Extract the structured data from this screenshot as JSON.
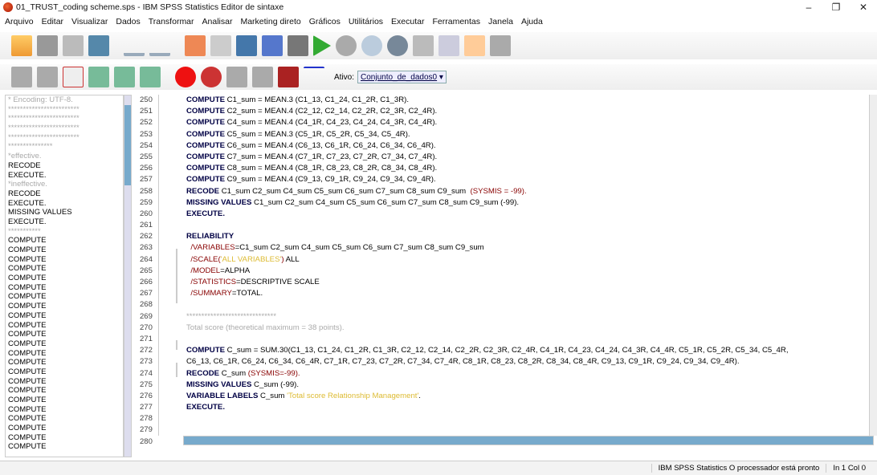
{
  "title": "01_TRUST_coding scheme.sps - IBM SPSS Statistics Editor de sintaxe",
  "menu": [
    "Arquivo",
    "Editar",
    "Visualizar",
    "Dados",
    "Transformar",
    "Analisar",
    "Marketing direto",
    "Gráficos",
    "Utilitários",
    "Executar",
    "Ferramentas",
    "Janela",
    "Ajuda"
  ],
  "ativo_label": "Ativo:",
  "dataset": "Conjunto_de_dados0",
  "nav": [
    {
      "t": "* Encoding: UTF-8.",
      "d": true
    },
    {
      "t": "************************",
      "d": true
    },
    {
      "t": "************************",
      "d": true
    },
    {
      "t": "************************",
      "d": true
    },
    {
      "t": "************************",
      "d": true
    },
    {
      "t": "***************",
      "d": true
    },
    {
      "t": "*effective.",
      "d": true
    },
    {
      "t": "RECODE",
      "d": false
    },
    {
      "t": "EXECUTE.",
      "d": false
    },
    {
      "t": "*ineffective.",
      "d": true
    },
    {
      "t": "RECODE",
      "d": false
    },
    {
      "t": "EXECUTE.",
      "d": false
    },
    {
      "t": "MISSING VALUES",
      "d": false
    },
    {
      "t": "EXECUTE.",
      "d": false
    },
    {
      "t": "***********",
      "d": true
    },
    {
      "t": "COMPUTE",
      "d": false
    },
    {
      "t": "COMPUTE",
      "d": false
    },
    {
      "t": "COMPUTE",
      "d": false
    },
    {
      "t": "COMPUTE",
      "d": false
    },
    {
      "t": "COMPUTE",
      "d": false
    },
    {
      "t": "COMPUTE",
      "d": false
    },
    {
      "t": "COMPUTE",
      "d": false
    },
    {
      "t": "COMPUTE",
      "d": false
    },
    {
      "t": "COMPUTE",
      "d": false
    },
    {
      "t": "COMPUTE",
      "d": false
    },
    {
      "t": "COMPUTE",
      "d": false
    },
    {
      "t": "COMPUTE",
      "d": false
    },
    {
      "t": "COMPUTE",
      "d": false
    },
    {
      "t": "COMPUTE",
      "d": false
    },
    {
      "t": "COMPUTE",
      "d": false
    },
    {
      "t": "COMPUTE",
      "d": false
    },
    {
      "t": "COMPUTE",
      "d": false
    },
    {
      "t": "COMPUTE",
      "d": false
    },
    {
      "t": "COMPUTE",
      "d": false
    },
    {
      "t": "COMPUTE",
      "d": false
    },
    {
      "t": "COMPUTE",
      "d": false
    },
    {
      "t": "COMPUTE",
      "d": false
    },
    {
      "t": "COMPUTE",
      "d": false
    }
  ],
  "lines": [
    {
      "n": "250",
      "segs": [
        [
          "kw",
          "COMPUTE"
        ],
        [
          "pl",
          " C1_sum = MEAN.3 (C1_13, C1_24, C1_2R, C1_3R)."
        ]
      ]
    },
    {
      "n": "251",
      "segs": [
        [
          "kw",
          "COMPUTE"
        ],
        [
          "pl",
          " C2_sum = MEAN.4 (C2_12, C2_14, C2_2R, C2_3R, C2_4R)."
        ]
      ]
    },
    {
      "n": "252",
      "segs": [
        [
          "kw",
          "COMPUTE"
        ],
        [
          "pl",
          " C4_sum = MEAN.4 (C4_1R, C4_23, C4_24, C4_3R, C4_4R)."
        ]
      ]
    },
    {
      "n": "253",
      "segs": [
        [
          "kw",
          "COMPUTE"
        ],
        [
          "pl",
          " C5_sum = MEAN.3 (C5_1R, C5_2R, C5_34, C5_4R)."
        ]
      ]
    },
    {
      "n": "254",
      "segs": [
        [
          "kw",
          "COMPUTE"
        ],
        [
          "pl",
          " C6_sum = MEAN.4 (C6_13, C6_1R, C6_24, C6_34, C6_4R)."
        ]
      ]
    },
    {
      "n": "255",
      "segs": [
        [
          "kw",
          "COMPUTE"
        ],
        [
          "pl",
          " C7_sum = MEAN.4 (C7_1R, C7_23, C7_2R, C7_34, C7_4R)."
        ]
      ]
    },
    {
      "n": "256",
      "segs": [
        [
          "kw",
          "COMPUTE"
        ],
        [
          "pl",
          " C8_sum = MEAN.4 (C8_1R, C8_23, C8_2R, C8_34, C8_4R)."
        ]
      ]
    },
    {
      "n": "257",
      "segs": [
        [
          "kw",
          "COMPUTE"
        ],
        [
          "pl",
          " C9_sum = MEAN.4 (C9_13, C9_1R, C9_24, C9_34, C9_4R)."
        ]
      ]
    },
    {
      "n": "258",
      "segs": [
        [
          "kw",
          "RECODE"
        ],
        [
          "pl",
          " C1_sum C2_sum C4_sum C5_sum C6_sum C7_sum C8_sum C9_sum  "
        ],
        [
          "sub",
          "(SYSMIS = -99)."
        ]
      ]
    },
    {
      "n": "259",
      "segs": [
        [
          "kw",
          "MISSING VALUES"
        ],
        [
          "pl",
          " C1_sum C2_sum C4_sum C5_sum C6_sum C7_sum C8_sum C9_sum (-99)."
        ]
      ]
    },
    {
      "n": "260",
      "segs": [
        [
          "kw",
          "EXECUTE."
        ]
      ]
    },
    {
      "n": "261",
      "segs": []
    },
    {
      "n": "262",
      "segs": [
        [
          "kw",
          "RELIABILITY"
        ]
      ]
    },
    {
      "n": "263",
      "segs": [
        [
          "sub",
          "  /VARIABLES"
        ],
        [
          "pl",
          "=C1_sum C2_sum C4_sum C5_sum C6_sum C7_sum C8_sum C9_sum"
        ]
      ]
    },
    {
      "n": "264",
      "segs": [
        [
          "sub",
          "  /SCALE("
        ],
        [
          "str",
          "'ALL VARIABLES'"
        ],
        [
          "sub",
          ")"
        ],
        [
          "pl",
          " ALL"
        ]
      ]
    },
    {
      "n": "265",
      "segs": [
        [
          "sub",
          "  /MODEL"
        ],
        [
          "pl",
          "=ALPHA"
        ]
      ]
    },
    {
      "n": "266",
      "segs": [
        [
          "sub",
          "  /STATISTICS"
        ],
        [
          "pl",
          "=DESCRIPTIVE SCALE"
        ]
      ]
    },
    {
      "n": "267",
      "segs": [
        [
          "sub",
          "  /SUMMARY"
        ],
        [
          "pl",
          "=TOTAL."
        ]
      ]
    },
    {
      "n": "268",
      "segs": []
    },
    {
      "n": "269",
      "segs": [
        [
          "cm",
          "******************************"
        ]
      ]
    },
    {
      "n": "270",
      "segs": [
        [
          "cm",
          "Total score (theoretical maximum = 38 points)."
        ]
      ]
    },
    {
      "n": "271",
      "segs": []
    },
    {
      "n": "272",
      "segs": [
        [
          "kw",
          "COMPUTE"
        ],
        [
          "pl",
          " C_sum = SUM.30(C1_13, C1_24, C1_2R, C1_3R, C2_12, C2_14, C2_2R, C2_3R, C2_4R, C4_1R, C4_23, C4_24, C4_3R, C4_4R, C5_1R, C5_2R, C5_34, C5_4R,"
        ]
      ]
    },
    {
      "n": "273",
      "segs": [
        [
          "pl",
          "C6_13, C6_1R, C6_24, C6_34, C6_4R, C7_1R, C7_23, C7_2R, C7_34, C7_4R, C8_1R, C8_23, C8_2R, C8_34, C8_4R, C9_13, C9_1R, C9_24, C9_34, C9_4R)."
        ]
      ]
    },
    {
      "n": "274",
      "segs": [
        [
          "kw",
          "RECODE"
        ],
        [
          "pl",
          " C_sum "
        ],
        [
          "sub",
          "(SYSMIS=-99)."
        ]
      ]
    },
    {
      "n": "275",
      "segs": [
        [
          "kw",
          "MISSING VALUES"
        ],
        [
          "pl",
          " C_sum (-99)."
        ]
      ]
    },
    {
      "n": "276",
      "segs": [
        [
          "kw",
          "VARIABLE LABELS"
        ],
        [
          "pl",
          " C_sum "
        ],
        [
          "str",
          "'Total score Relationship Management'"
        ],
        [
          "pl",
          "."
        ]
      ]
    },
    {
      "n": "277",
      "segs": [
        [
          "kw",
          "EXECUTE."
        ]
      ]
    },
    {
      "n": "278",
      "segs": []
    },
    {
      "n": "279",
      "segs": []
    },
    {
      "n": "280",
      "segs": []
    }
  ],
  "status": {
    "main": "IBM SPSS Statistics O processador está pronto",
    "pos": "In 1 Col 0"
  }
}
